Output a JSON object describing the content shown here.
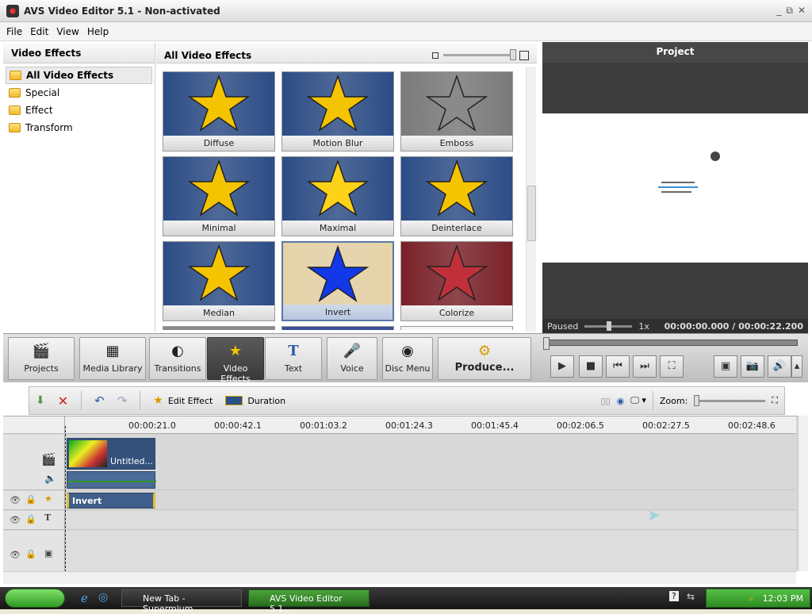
{
  "window": {
    "title": "AVS Video Editor 5.1 - Non-activated",
    "controls": [
      "_",
      "⧉",
      "✕"
    ]
  },
  "menu": [
    "File",
    "Edit",
    "View",
    "Help"
  ],
  "left_panel": {
    "title": "Video Effects",
    "items": [
      {
        "label": "All Video Effects",
        "selected": true
      },
      {
        "label": "Special",
        "selected": false
      },
      {
        "label": "Effect",
        "selected": false
      },
      {
        "label": "Transform",
        "selected": false
      }
    ]
  },
  "gallery": {
    "title": "All Video Effects",
    "tiles": [
      {
        "label": "Diffuse",
        "bg": "#2b4c86",
        "star": "#f5c400"
      },
      {
        "label": "Motion Blur",
        "bg": "#2b4c86",
        "star": "#f5c400"
      },
      {
        "label": "Emboss",
        "bg": "#7a7a7a",
        "star": "#8a8a8a"
      },
      {
        "label": "Minimal",
        "bg": "#2b4c86",
        "star": "#f5c400"
      },
      {
        "label": "Maximal",
        "bg": "#2b4c86",
        "star": "#ffd21a"
      },
      {
        "label": "Deinterlace",
        "bg": "#2b4c86",
        "star": "#f5c400"
      },
      {
        "label": "Median",
        "bg": "#2b4c86",
        "star": "#f5c400"
      },
      {
        "label": "Invert",
        "bg": "#e6d3a6",
        "star": "#1238e8",
        "selected": true
      },
      {
        "label": "Colorize",
        "bg": "#7a2028",
        "star": "#c0303a"
      }
    ]
  },
  "preview": {
    "title": "Project",
    "status": "Paused",
    "speed": "1x",
    "time": "00:00:00.000 / 00:00:22.200"
  },
  "toolbar": {
    "buttons": [
      {
        "label": "Projects",
        "icon": "clapper-icon",
        "glyph": "🎬"
      },
      {
        "label": "Media Library",
        "icon": "film-grid-icon",
        "glyph": "▦"
      },
      {
        "label": "Transitions",
        "icon": "transition-icon",
        "glyph": "◐"
      },
      {
        "label": "Video Effects",
        "icon": "video-effects-icon",
        "glyph": "★",
        "active": true
      },
      {
        "label": "Text",
        "icon": "text-icon",
        "glyph": "T"
      },
      {
        "label": "Voice",
        "icon": "microphone-icon",
        "glyph": "🎤"
      },
      {
        "label": "Disc Menu",
        "icon": "disc-icon",
        "glyph": "◉"
      },
      {
        "label": "Produce...",
        "icon": "produce-icon",
        "glyph": "⚙"
      }
    ]
  },
  "player_buttons": [
    {
      "name": "play-button",
      "glyph": "▶"
    },
    {
      "name": "stop-button",
      "glyph": "■"
    },
    {
      "name": "previous-button",
      "glyph": "⏮"
    },
    {
      "name": "next-button",
      "glyph": "⏭"
    },
    {
      "name": "fullscreen-button",
      "glyph": "⛶"
    },
    {
      "name": "fit-button",
      "glyph": "▣"
    },
    {
      "name": "snapshot-button",
      "glyph": "📷"
    },
    {
      "name": "volume-button",
      "glyph": "🔊"
    },
    {
      "name": "more-button",
      "glyph": "▴"
    }
  ],
  "timeline_bar": {
    "edit_effect": "Edit Effect",
    "duration": "Duration",
    "zoom_label": "Zoom:"
  },
  "ruler": [
    "00:00:21.0",
    "00:00:42.1",
    "00:01:03.2",
    "00:01:24.3",
    "00:01:45.4",
    "00:02:06.5",
    "00:02:27.5",
    "00:02:48.6"
  ],
  "timeline": {
    "video_clip": "Untitled...",
    "effect_clip": "Invert"
  },
  "taskbar": {
    "tasks": [
      {
        "label": "New Tab - Supermium",
        "active": false
      },
      {
        "label": "AVS Video Editor 5.1...",
        "active": true
      }
    ],
    "clock": "12:03 PM"
  }
}
